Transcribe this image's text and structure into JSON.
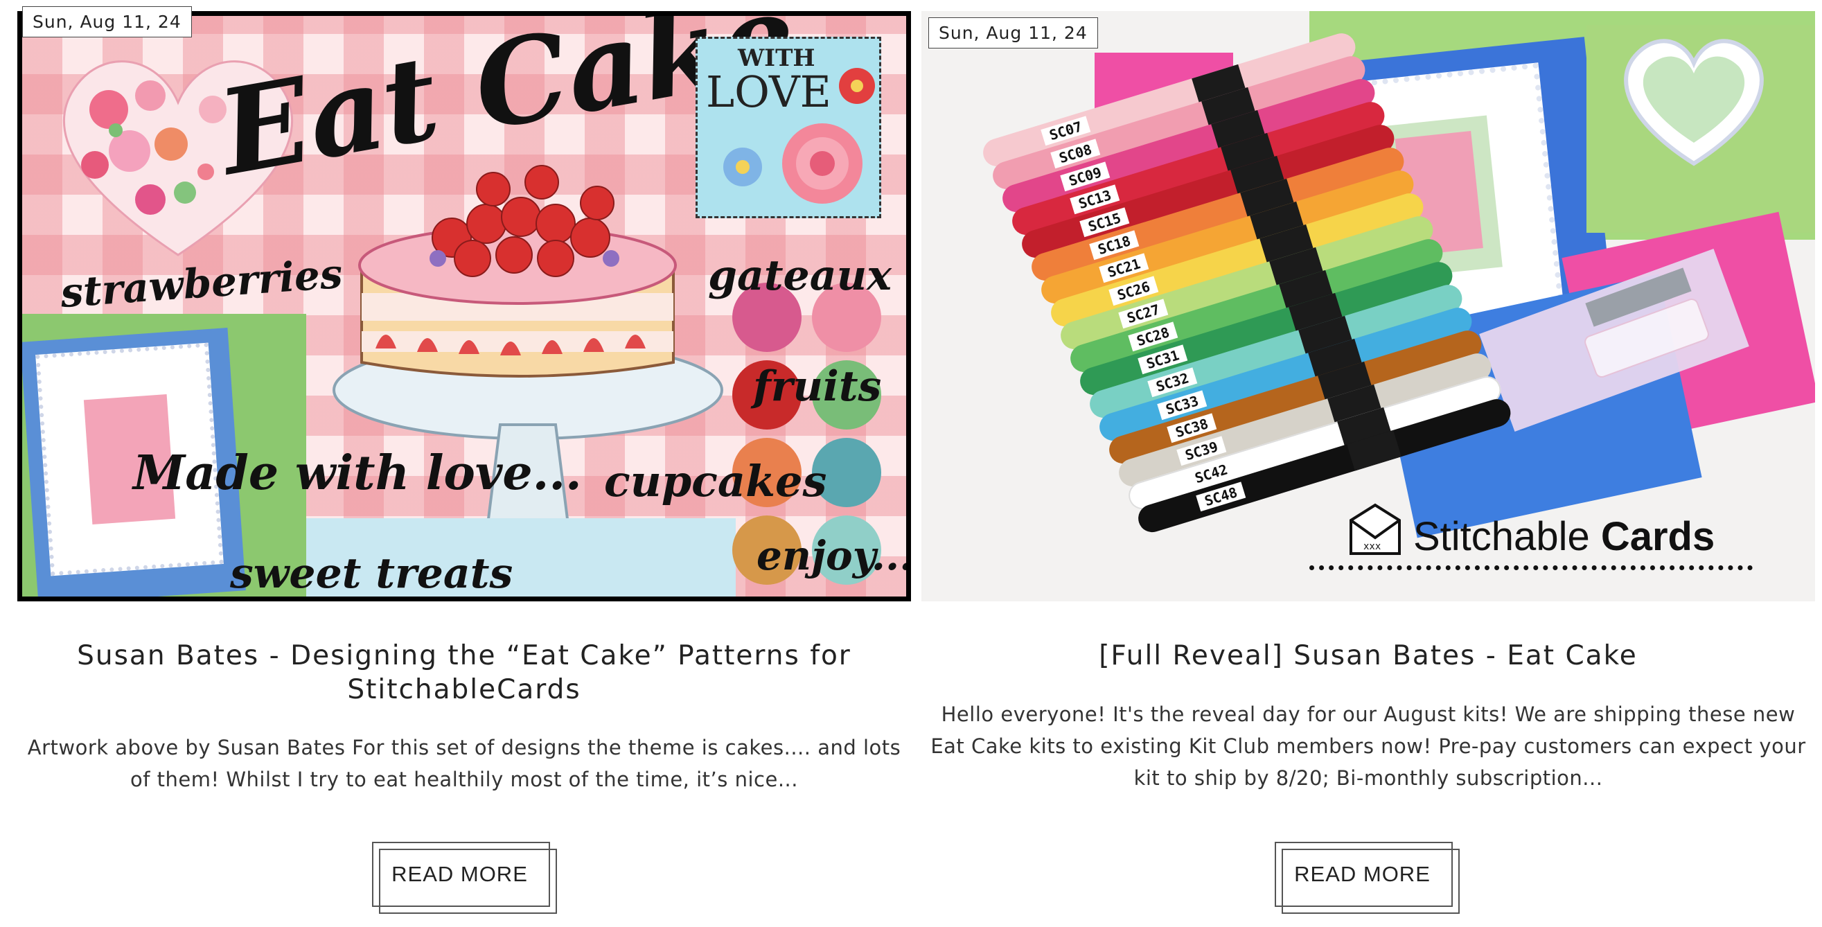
{
  "posts": [
    {
      "date": "Sun, Aug 11, 24",
      "title": "Susan Bates - Designing the “Eat Cake” Patterns for StitchableCards",
      "excerpt": "Artwork above by Susan Bates For this set of designs the theme is cakes.... and lots of them! Whilst I try to eat healthily most of the time, it’s nice...",
      "button": "READ MORE",
      "image": {
        "heading": "Eat Cake",
        "badge_line1": "WITH",
        "badge_line2": "LOVE",
        "words": [
          "strawberries",
          "gateaux",
          "fruits",
          "Made with love...",
          "cupcakes",
          "sweet treats",
          "enjoy..."
        ],
        "swatches": [
          "#d75a8e",
          "#ef8fa6",
          "#c82a2a",
          "#79bd78",
          "#e9804e",
          "#5aa7b0",
          "#d6984a",
          "#90cfc8"
        ]
      }
    },
    {
      "date": "Sun, Aug 11, 24",
      "title": "[Full Reveal] Susan Bates - Eat Cake",
      "excerpt": "Hello everyone! It's the reveal day for our August kits!  We are shipping these new Eat Cake kits to existing Kit Club members now! Pre-pay customers can expect your kit to ship by 8/20; Bi-monthly subscription...",
      "button": "READ MORE",
      "image": {
        "brand_light": "Stitchable",
        "brand_bold": "Cards",
        "threads": [
          {
            "code": "SC07",
            "color": "#f6c9cf"
          },
          {
            "code": "SC08",
            "color": "#f19db0"
          },
          {
            "code": "SC09",
            "color": "#e2468a"
          },
          {
            "code": "SC13",
            "color": "#d8283f"
          },
          {
            "code": "SC15",
            "color": "#c21f2c"
          },
          {
            "code": "SC18",
            "color": "#ef7f3a"
          },
          {
            "code": "SC21",
            "color": "#f5a534"
          },
          {
            "code": "SC26",
            "color": "#f6d44a"
          },
          {
            "code": "SC27",
            "color": "#b9dc7c"
          },
          {
            "code": "SC28",
            "color": "#5fbd61"
          },
          {
            "code": "SC31",
            "color": "#2f9a55"
          },
          {
            "code": "SC32",
            "color": "#79d0c4"
          },
          {
            "code": "SC33",
            "color": "#43aee0"
          },
          {
            "code": "SC38",
            "color": "#b5651d"
          },
          {
            "code": "SC39",
            "color": "#d6d2c9"
          },
          {
            "code": "SC42",
            "color": "#ffffff"
          },
          {
            "code": "SC48",
            "color": "#111111"
          }
        ]
      }
    }
  ]
}
